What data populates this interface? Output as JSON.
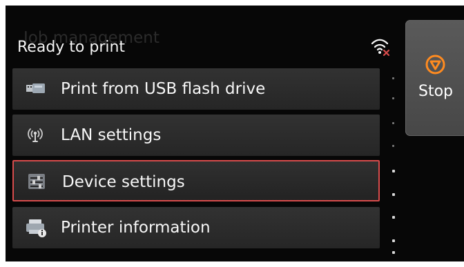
{
  "status": {
    "text": "Ready to print",
    "background_text": "Job management"
  },
  "wifi_indicator": {
    "icon": "wifi-disconnected-icon",
    "status_color": "#d84c4c"
  },
  "menu": {
    "items": [
      {
        "label": "Print from USB flash drive",
        "icon": "usb-flash-drive-icon"
      },
      {
        "label": "LAN settings",
        "icon": "lan-antenna-icon"
      },
      {
        "label": "Device settings",
        "icon": "device-settings-icon"
      },
      {
        "label": "Printer information",
        "icon": "printer-information-icon"
      }
    ],
    "selected_label": "Device settings",
    "selection_color": "#d84c4c"
  },
  "stop_button": {
    "label": "Stop",
    "icon": "stop-icon",
    "icon_color": "#ff8b20"
  }
}
